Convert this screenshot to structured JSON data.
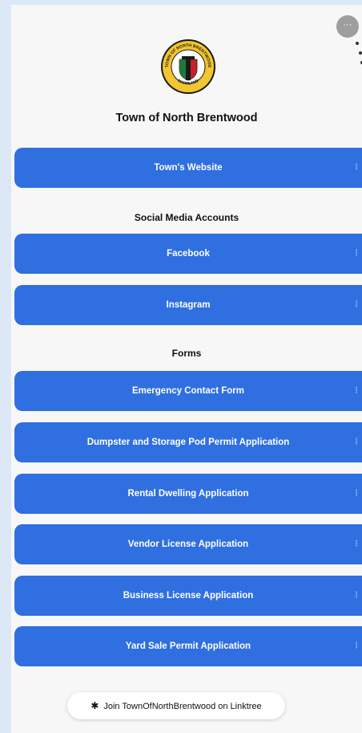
{
  "header": {
    "more_icon": "ellipsis-icon",
    "more_label": "···",
    "profile_name": "Town of North Brentwood"
  },
  "logo": {
    "ring_top": "TOWN OF NORTH BRENTWOOD",
    "ring_bottom": "MARYLAND",
    "year": "1924",
    "colors": {
      "ring": "#f2c531",
      "border": "#1a1a1a",
      "red": "#c8202a",
      "green": "#1f7a3a"
    }
  },
  "links": {
    "towns_website": "Town's Website",
    "social_heading": "Social Media Accounts",
    "facebook": "Facebook",
    "instagram": "Instagram",
    "forms_heading": "Forms",
    "emergency_contact": "Emergency Contact Form",
    "dumpster": "Dumpster and Storage Pod Permit Application",
    "rental": "Rental Dwelling Application",
    "vendor": "Vendor License Application",
    "business": "Business License Application",
    "yard_sale": "Yard Sale Permit Application",
    "kebab_icon": "kebab-menu-icon",
    "kebab_glyph": "⋮"
  },
  "footer": {
    "tree_icon": "linktree-icon",
    "tree_glyph": "✱",
    "join_label": "Join TownOfNorthBrentwood on Linktree"
  },
  "theme": {
    "button_color": "#2f6fe0",
    "background": "#f7f7f7"
  }
}
